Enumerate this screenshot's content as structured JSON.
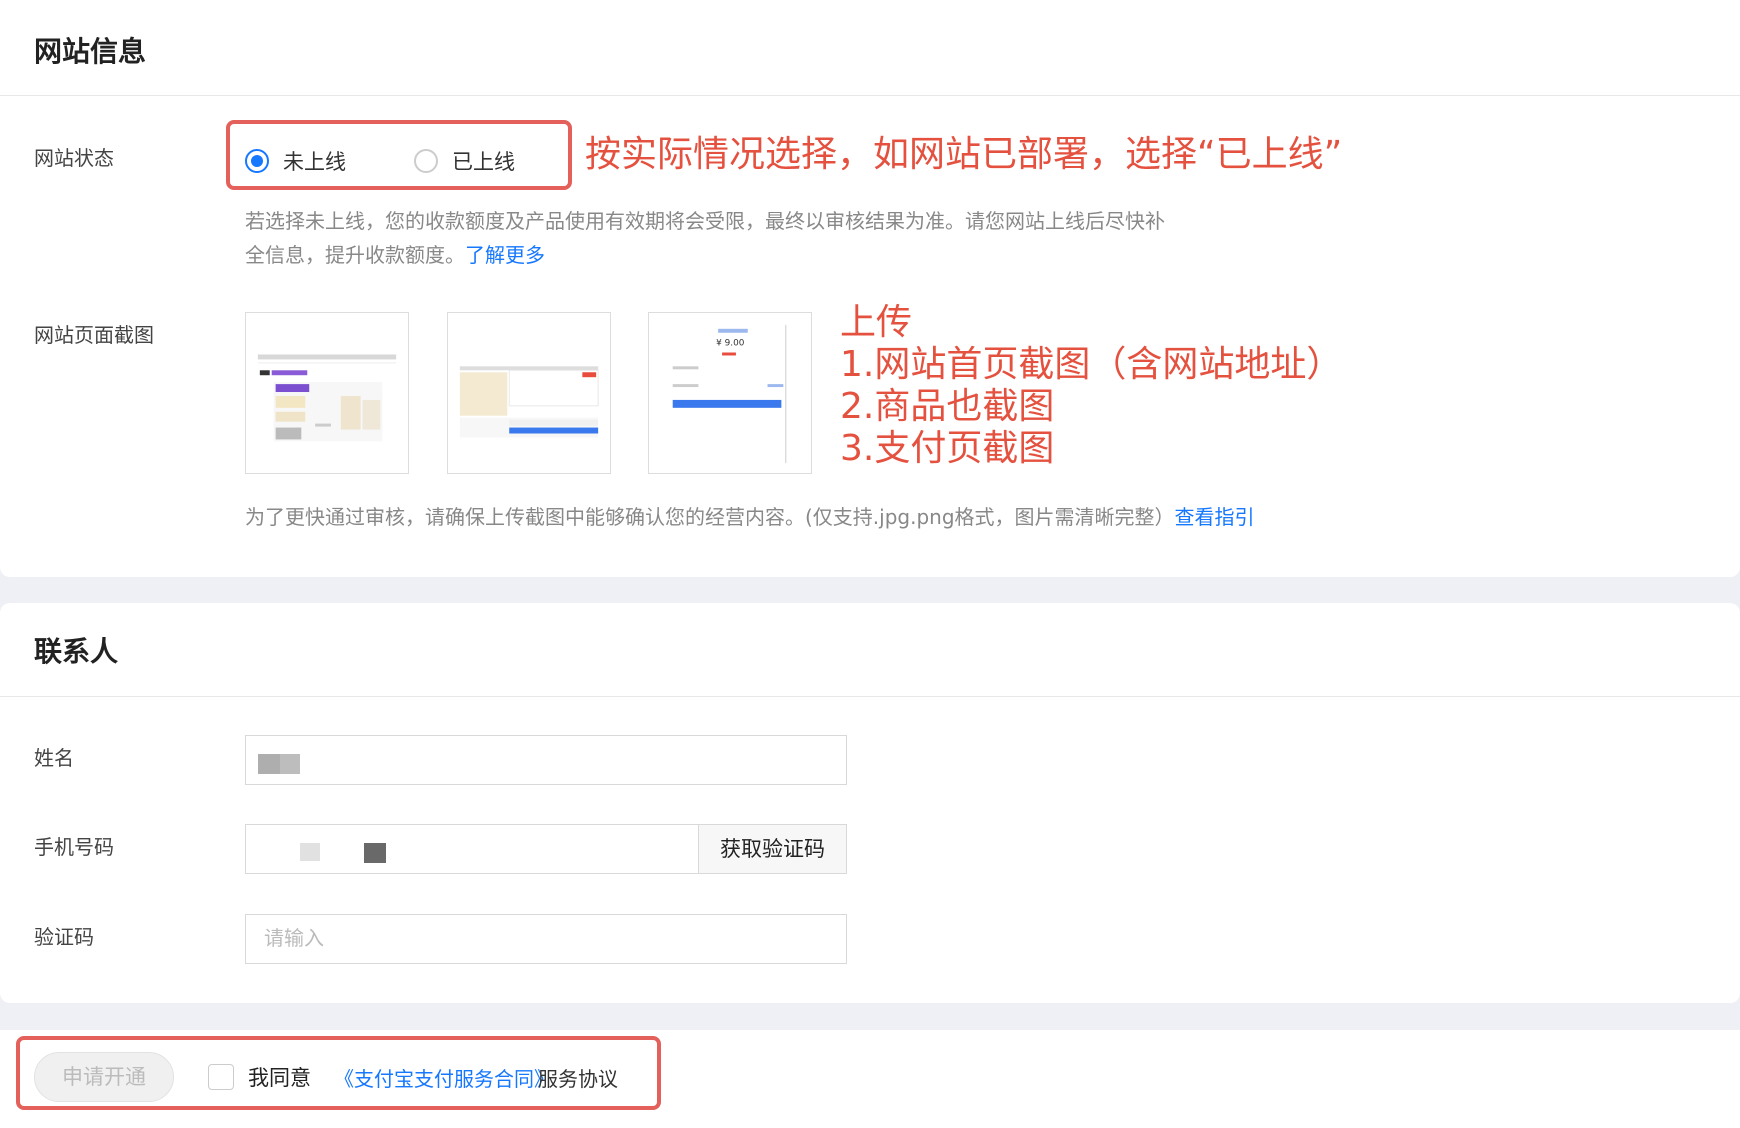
{
  "website_section": {
    "title": "网站信息",
    "status_label": "网站状态",
    "status_options": [
      "未上线",
      "已上线"
    ],
    "status_selected": "未上线",
    "status_hint_line1": "若选择未上线，您的收款额度及产品使用有效期将会受限，最终以审核结果为准。请您网站上线后尽快补",
    "status_hint_line2": "全信息，提升收款额度。",
    "learn_more": "了解更多",
    "screenshot_label": "网站页面截图",
    "screenshot_hint": "为了更快通过审核，请确保上传截图中能够确认您的经营内容。(仅支持.jpg.png格式，图片需清晰完整）",
    "view_guide": "查看指引",
    "thumb3_price": "¥ 9.00"
  },
  "annotations": {
    "status_note": "按实际情况选择，如网站已部署，选择“已上线”",
    "upload_lines": [
      "上传",
      "1.网站首页截图（含网站地址）",
      "2.商品也截图",
      "3.支付页截图"
    ],
    "color": "#e4605a"
  },
  "contact_section": {
    "title": "联系人",
    "name_label": "姓名",
    "phone_label": "手机号码",
    "get_code": "获取验证码",
    "code_label": "验证码",
    "code_placeholder": "请输入"
  },
  "footer": {
    "apply_button": "申请开通",
    "agree": "我同意",
    "contract_link": "《支付宝支付服务合同》",
    "service_agreement": "服务协议"
  },
  "colors": {
    "accent": "#1677ff",
    "annotation": "#e4513f"
  }
}
